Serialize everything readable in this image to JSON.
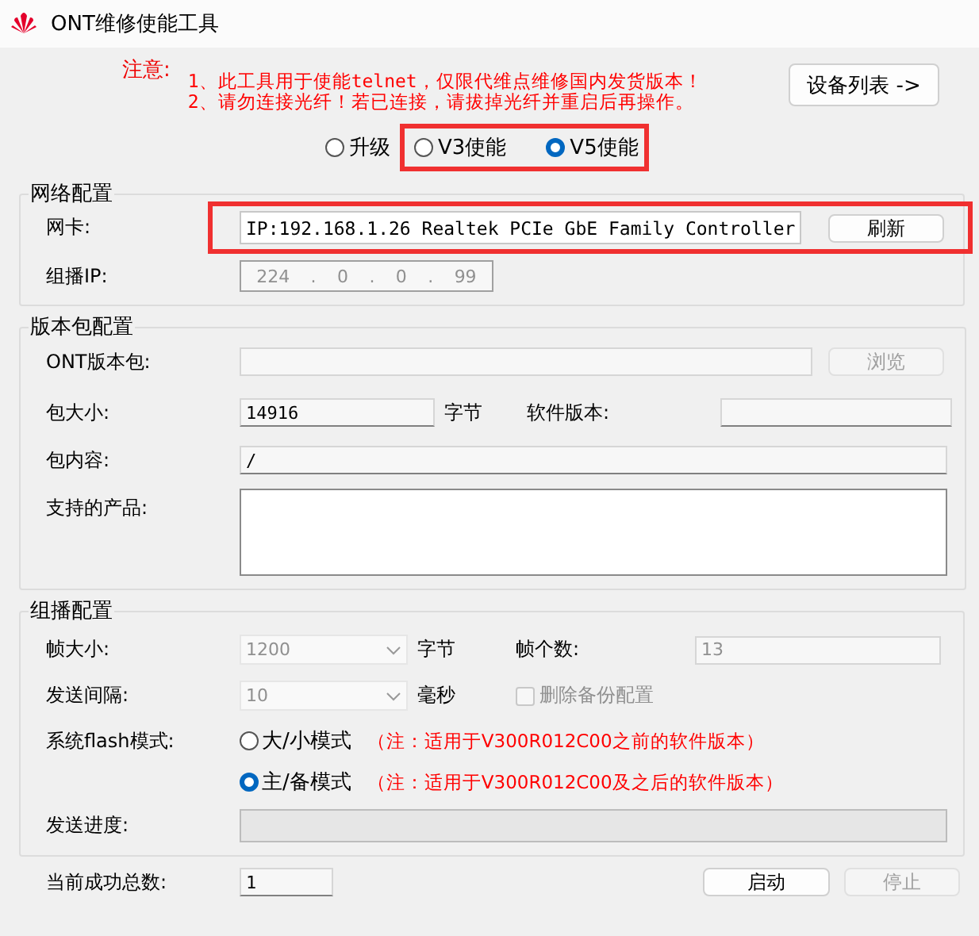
{
  "window": {
    "title": "ONT维修使能工具"
  },
  "notice": {
    "label": "注意:",
    "lines": [
      "1、此工具用于使能telnet，仅限代维点维修国内发货版本！",
      "2、请勿连接光纤！若已连接，请拔掉光纤并重启后再操作。"
    ]
  },
  "device_list_button": "设备列表 ->",
  "modes": [
    {
      "label": "升级",
      "selected": false,
      "highlighted": false
    },
    {
      "label": "V3使能",
      "selected": false,
      "highlighted": true
    },
    {
      "label": "V5使能",
      "selected": true,
      "highlighted": true
    }
  ],
  "network": {
    "title": "网络配置",
    "nic": {
      "label": "网卡:",
      "value": "IP:192.168.1.26 Realtek PCIe GbE Family Controller",
      "highlighted": true
    },
    "refresh_button": "刷新",
    "multicast_ip": {
      "label": "组播IP:",
      "octets": [
        "224",
        "0",
        "0",
        "99"
      ],
      "separator": ".",
      "disabled": true
    }
  },
  "package": {
    "title": "版本包配置",
    "ont_package": {
      "label": "ONT版本包:",
      "disabled": true
    },
    "browse_button": {
      "label": "浏览",
      "disabled": true
    },
    "size": {
      "label": "包大小:",
      "value": "14916",
      "unit": "字节"
    },
    "software_version": {
      "label": "软件版本:"
    },
    "content": {
      "label": "包内容:",
      "value": "/"
    },
    "supported_products": {
      "label": "支持的产品:"
    }
  },
  "multicast": {
    "title": "组播配置",
    "frame_size": {
      "label": "帧大小:",
      "value": "1200",
      "unit": "字节",
      "disabled": true
    },
    "frame_count": {
      "label": "帧个数:",
      "value": "13",
      "disabled": true
    },
    "interval": {
      "label": "发送间隔:",
      "value": "10",
      "unit": "毫秒",
      "disabled": true
    },
    "delete_backup": {
      "label": "删除备份配置",
      "checked": false,
      "disabled": true
    },
    "flash_mode": {
      "label": "系统flash模式:",
      "options": [
        {
          "label": "大/小模式",
          "note": "（注：适用于V300R012C00之前的软件版本）",
          "selected": false
        },
        {
          "label": "主/备模式",
          "note": "（注：适用于V300R012C00及之后的软件版本）",
          "selected": true
        }
      ]
    },
    "progress": {
      "label": "发送进度:"
    }
  },
  "footer": {
    "success_label": "当前成功总数:",
    "success_count": "1",
    "start_button": {
      "label": "启动",
      "disabled": false
    },
    "stop_button": {
      "label": "停止",
      "disabled": true
    }
  }
}
